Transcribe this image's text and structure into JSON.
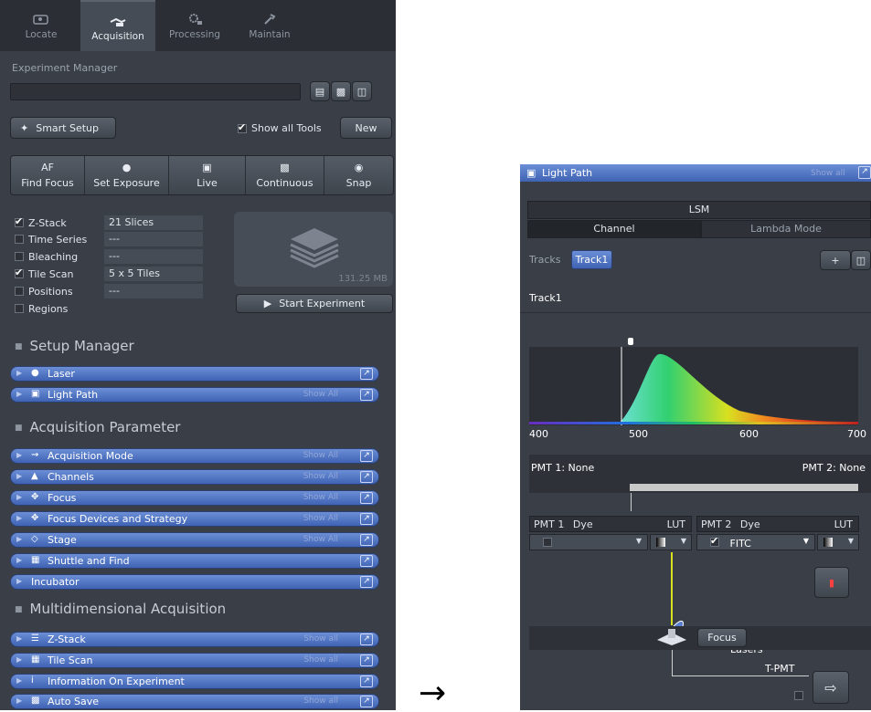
{
  "tabs": [
    {
      "label": "Locate"
    },
    {
      "label": "Acquisition"
    },
    {
      "label": "Processing"
    },
    {
      "label": "Maintain"
    }
  ],
  "experiment_manager": {
    "label": "Experiment Manager",
    "value": ""
  },
  "smart_setup": {
    "label": "Smart Setup"
  },
  "show_all_tools": {
    "label": "Show all Tools",
    "checked": true
  },
  "new_button": {
    "label": "New"
  },
  "tools": [
    {
      "top": "AF",
      "label": "Find Focus"
    },
    {
      "top": "",
      "label": "Set Exposure"
    },
    {
      "top": "",
      "label": "Live"
    },
    {
      "top": "",
      "label": "Continuous"
    },
    {
      "top": "",
      "label": "Snap"
    }
  ],
  "options": [
    {
      "label": "Z-Stack",
      "checked": true,
      "value": "21 Slices"
    },
    {
      "label": "Time Series",
      "checked": false,
      "value": "---"
    },
    {
      "label": "Bleaching",
      "checked": false,
      "value": "---"
    },
    {
      "label": "Tile Scan",
      "checked": true,
      "value": "5 x 5 Tiles"
    },
    {
      "label": "Positions",
      "checked": false,
      "value": "---"
    },
    {
      "label": "Regions",
      "checked": false,
      "value": ""
    }
  ],
  "preview_size": "131.25 MB",
  "start_experiment": {
    "label": "Start Experiment"
  },
  "groups": [
    {
      "title": "Setup Manager",
      "items": [
        {
          "label": "Laser",
          "icon": "laser-icon",
          "show_all": ""
        },
        {
          "label": "Light Path",
          "icon": "light-path-icon",
          "show_all": "Show All"
        }
      ]
    },
    {
      "title": "Acquisition Parameter",
      "items": [
        {
          "label": "Acquisition Mode",
          "icon": "acquisition-mode-icon",
          "show_all": "Show All"
        },
        {
          "label": "Channels",
          "icon": "channels-icon",
          "show_all": "Show All"
        },
        {
          "label": "Focus",
          "icon": "focus-icon",
          "show_all": "Show All"
        },
        {
          "label": "Focus Devices and Strategy",
          "icon": "focus-devices-icon",
          "show_all": "Show All"
        },
        {
          "label": "Stage",
          "icon": "stage-icon",
          "show_all": "Show All"
        },
        {
          "label": "Shuttle and Find",
          "icon": "shuttle-icon",
          "show_all": ""
        },
        {
          "label": "Incubator",
          "icon": "",
          "show_all": ""
        }
      ]
    },
    {
      "title": "Multidimensional Acquisition",
      "items": [
        {
          "label": "Z-Stack",
          "icon": "z-stack-icon",
          "show_all": "Show all"
        },
        {
          "label": "Tile Scan",
          "icon": "tile-scan-icon",
          "show_all": "Show all"
        },
        {
          "label": "Information On Experiment",
          "icon": "info-icon",
          "show_all": ""
        },
        {
          "label": "Auto Save",
          "icon": "save-icon",
          "show_all": "Show all"
        }
      ]
    }
  ],
  "arrow": "→",
  "light_path": {
    "title": "Light Path",
    "show_all": "Show all",
    "mode": "LSM",
    "subtabs": [
      "Channel",
      "Lambda Mode"
    ],
    "tracks_label": "Tracks",
    "track": "Track1",
    "add": "+",
    "track_title": "Track1",
    "axis": [
      "400",
      "500",
      "600",
      "700"
    ],
    "pmt_left": "PMT 1: None",
    "pmt_right": "PMT 2: None",
    "pmt1": {
      "name": "PMT 1",
      "dye": "Dye",
      "lut": "LUT",
      "checked": false,
      "value": ""
    },
    "pmt2": {
      "name": "PMT 2",
      "dye": "Dye",
      "lut": "LUT",
      "checked": true,
      "value": "FITC"
    },
    "lasers": "Lasers",
    "focus": "Focus",
    "tpmt": "T-PMT"
  }
}
